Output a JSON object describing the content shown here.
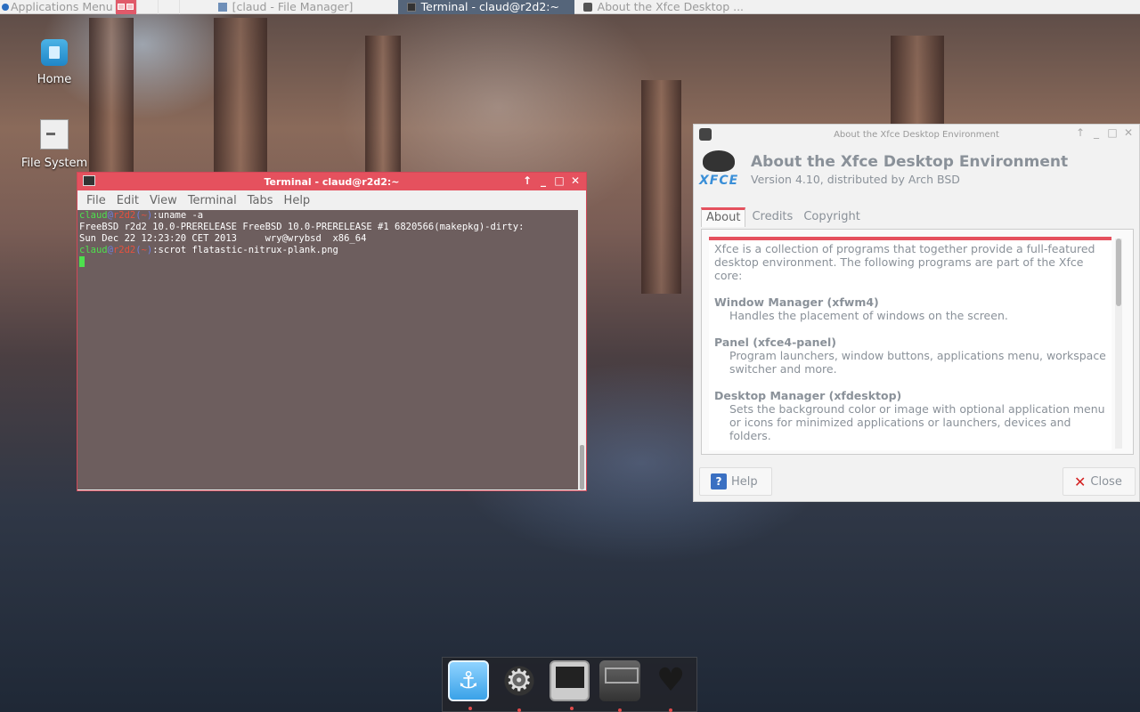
{
  "top_panel": {
    "apps_menu_label": "Applications Menu",
    "tasks": [
      {
        "label": "[claud - File Manager]",
        "active": false
      },
      {
        "label": "Terminal - claud@r2d2:~",
        "active": true
      },
      {
        "label": "About the Xfce Desktop ...",
        "active": false
      }
    ]
  },
  "desktop": {
    "icons": [
      {
        "label": "Home"
      },
      {
        "label": "File System"
      }
    ]
  },
  "terminal": {
    "title": "Terminal - claud@r2d2:~",
    "menu": [
      "File",
      "Edit",
      "View",
      "Terminal",
      "Tabs",
      "Help"
    ],
    "prompt_user": "claud",
    "prompt_host": "r2d2",
    "prompt_dir": "~",
    "cmd1": "uname -a",
    "out1": "FreeBSD r2d2 10.0-PRERELEASE FreeBSD 10.0-PRERELEASE #1 6820566(makepkg)-dirty:",
    "out2": "Sun Dec 22 12:23:20 CET 2013     wry@wrybsd  x86_64",
    "cmd2": "scrot flatastic-nitrux-plank.png"
  },
  "about": {
    "window_title": "About the Xfce Desktop Environment",
    "heading": "About the Xfce Desktop Environment",
    "version": "Version 4.10, distributed by Arch BSD",
    "logo_text": "XFCE",
    "tabs": [
      "About",
      "Credits",
      "Copyright"
    ],
    "intro": "Xfce is a collection of programs that together provide a full-featured desktop environment. The following programs are part of the Xfce core:",
    "sections": [
      {
        "title": "Window Manager (xfwm4)",
        "desc": "Handles the placement of windows on the screen."
      },
      {
        "title": "Panel (xfce4-panel)",
        "desc": "Program launchers, window buttons, applications menu, workspace switcher and more."
      },
      {
        "title": "Desktop Manager (xfdesktop)",
        "desc": "Sets the background color or image with optional application menu or icons for minimized applications or launchers, devices and folders."
      }
    ],
    "help_label": "Help",
    "close_label": "Close"
  },
  "dock": {
    "items": [
      "plank-icon",
      "settings-icon",
      "terminal-icon",
      "file-cabinet-icon",
      "heart-icon"
    ]
  }
}
